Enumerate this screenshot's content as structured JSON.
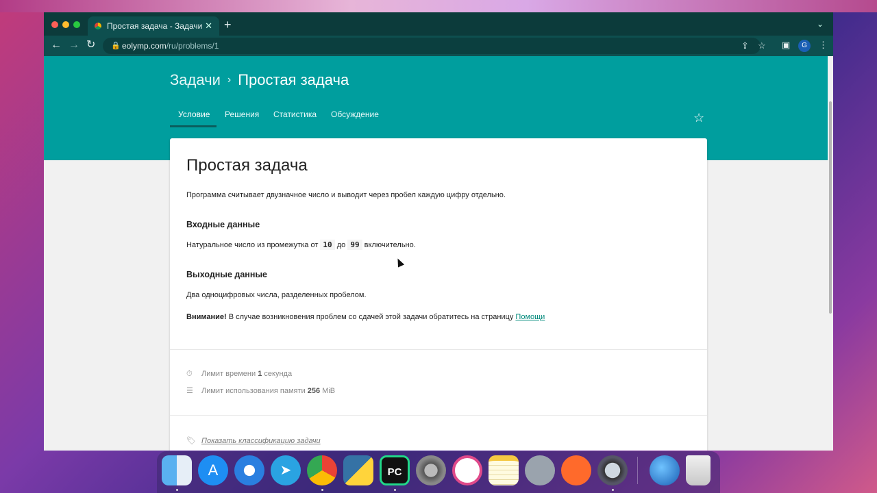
{
  "browser": {
    "tab_title": "Простая задача - Задачи - Eo",
    "new_tab_symbol": "+",
    "close_symbol": "✕",
    "url_domain": "eolymp.com",
    "url_path": "/ru/problems/1",
    "avatar_letter": "G"
  },
  "page": {
    "breadcrumb": {
      "root": "Задачи",
      "separator": "›",
      "current": "Простая задача"
    },
    "tabs": [
      {
        "label": "Условие",
        "active": true
      },
      {
        "label": "Решения",
        "active": false
      },
      {
        "label": "Статистика",
        "active": false
      },
      {
        "label": "Обсуждение",
        "active": false
      }
    ],
    "problem": {
      "title": "Простая задача",
      "statement": "Программа считывает двузначное число и выводит через пробел каждую цифру отдельно.",
      "input_heading": "Входные данные",
      "input_text_before": "Натуральное число из промежутка от",
      "input_code_1": "10",
      "input_text_mid": "до",
      "input_code_2": "99",
      "input_text_after": "включительно.",
      "output_heading": "Выходные данные",
      "output_text": "Два одноцифровых числа, разделенных пробелом.",
      "notice_bold": "Внимание!",
      "notice_text": "В случае возникновения проблем со сдачей этой задачи обратитесь на страницу",
      "notice_link": "Помощи"
    },
    "limits": {
      "time_label": "Лимит времени",
      "time_value": "1",
      "time_unit": "секунда",
      "memory_label": "Лимит использования памяти",
      "memory_value": "256",
      "memory_unit": "MiB"
    },
    "classification_link": "Показать классификацию задачи"
  },
  "dock": {
    "apps": [
      "finder-icon",
      "app-store-icon",
      "safari-icon",
      "telegram-icon",
      "chrome-icon",
      "python-launcher-icon",
      "pycharm-icon",
      "system-preferences-icon",
      "source-tree-icon",
      "notes-icon",
      "launchpad-icon",
      "sublime-icon",
      "quicktime-icon",
      "globe-icon",
      "trash-icon"
    ],
    "pycharm_label": "PC"
  },
  "colors": {
    "accent": "#009e9e",
    "chrome_frame": "#0c3b3b",
    "link": "#00897b"
  }
}
